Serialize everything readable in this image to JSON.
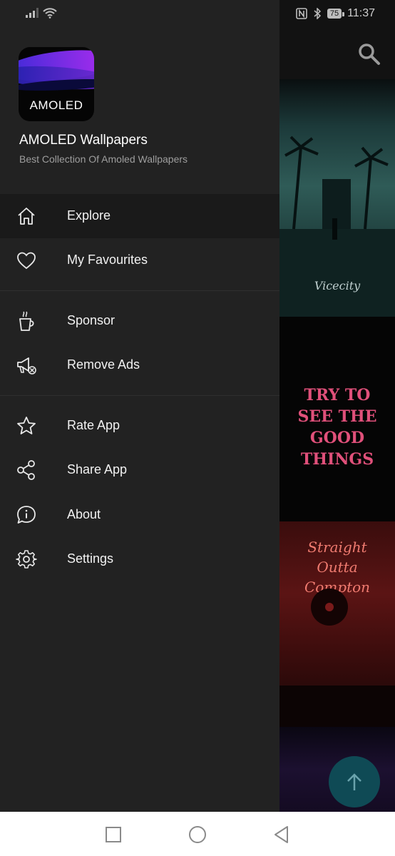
{
  "status_bar": {
    "time": "11:37",
    "battery": "75",
    "icons": [
      "signal-icon",
      "wifi-icon",
      "nfc-icon",
      "bluetooth-icon"
    ]
  },
  "background": {
    "tiles": [
      {
        "caption": "Vicecity"
      },
      {
        "caption": "TRY TO SEE THE GOOD THINGS"
      },
      {
        "caption": "Straight Outta Compton"
      }
    ]
  },
  "drawer": {
    "logo_text": "AMOLED",
    "app_title": "AMOLED Wallpapers",
    "app_subtitle": "Best Collection Of Amoled Wallpapers",
    "menu": [
      {
        "label": "Explore",
        "icon": "home-icon"
      },
      {
        "label": "My Favourites",
        "icon": "heart-icon"
      },
      {
        "label": "Sponsor",
        "icon": "coffee-cup-icon"
      },
      {
        "label": "Remove Ads",
        "icon": "megaphone-cancel-icon"
      },
      {
        "label": "Rate App",
        "icon": "star-icon"
      },
      {
        "label": "Share App",
        "icon": "share-icon"
      },
      {
        "label": "About",
        "icon": "info-bubble-icon"
      },
      {
        "label": "Settings",
        "icon": "gear-icon"
      }
    ]
  },
  "colors": {
    "drawer_bg": "#222222",
    "active_item_bg": "#1a1a1a",
    "fab": "#0f4a55"
  }
}
